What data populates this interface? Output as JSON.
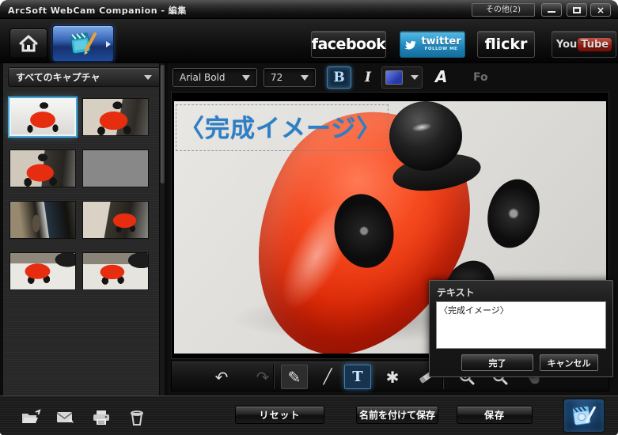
{
  "window": {
    "title": "ArcSoft WebCam Companion - 編集",
    "more_button": "その他(2)",
    "close_glyph": "×"
  },
  "nav": {
    "facebook": "facebook",
    "twitter": "twitter",
    "twitter_sub": "FOLLOW ME",
    "flickr": "flickr",
    "youtube_you": "You",
    "youtube_tube": "Tube"
  },
  "sidebar": {
    "filter": "すべてのキャプチャ",
    "thumbnails": [
      {
        "variant": "car-front",
        "selected": true
      },
      {
        "variant": "car-close",
        "selected": false
      },
      {
        "variant": "car-close2",
        "selected": false
      },
      {
        "variant": "room",
        "selected": false
      },
      {
        "variant": "room2",
        "selected": false
      },
      {
        "variant": "car-side",
        "selected": false
      },
      {
        "variant": "car-side2",
        "selected": false
      },
      {
        "variant": "car-side3",
        "selected": false
      }
    ]
  },
  "text_toolbar": {
    "font_family": "Arial Bold",
    "font_size": "72",
    "bold": "B",
    "italic": "I",
    "effect_a": "A",
    "effect_fo": "Fo",
    "text_color": "#3a56c4"
  },
  "canvas": {
    "overlay_text": "〈完成イメージ〉",
    "overlay_color": "#2e7ec5"
  },
  "dialog": {
    "title": "テキスト",
    "text_value": "〈完成イメージ〉",
    "done": "完了",
    "cancel": "キャンセル"
  },
  "tools": {
    "undo": "↶",
    "redo": "↷",
    "pencil": "✎",
    "line": "╱",
    "text": "T",
    "clipart": "✱"
  },
  "footer": {
    "reset": "リセット",
    "save_as": "名前を付けて保存",
    "save": "保存"
  }
}
